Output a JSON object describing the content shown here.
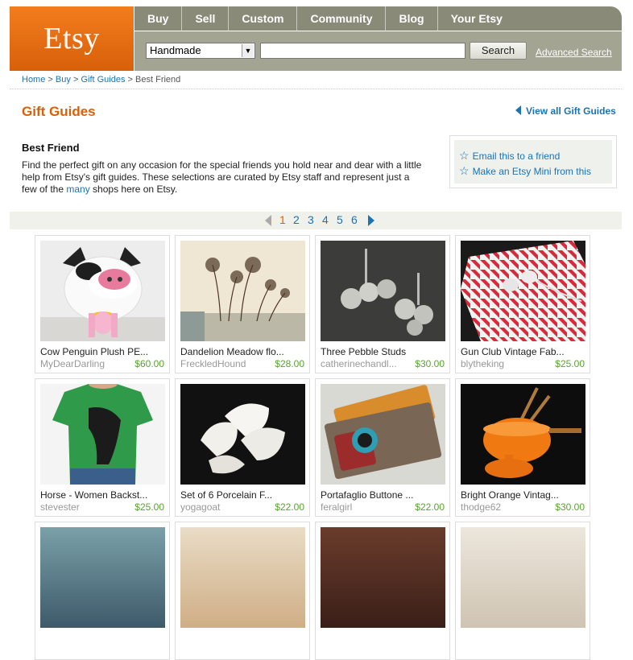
{
  "logo": "Etsy",
  "nav": [
    "Buy",
    "Sell",
    "Custom",
    "Community",
    "Blog",
    "Your Etsy"
  ],
  "search": {
    "category": "Handmade",
    "query": "",
    "button": "Search",
    "advanced": "Advanced Search"
  },
  "breadcrumb": {
    "home": "Home",
    "sep": ">",
    "buy": "Buy",
    "guides": "Gift Guides",
    "current": "Best Friend"
  },
  "page_title": "Gift Guides",
  "view_all": "View all Gift Guides",
  "section_title": "Best Friend",
  "description": {
    "before": "Find the perfect gift on any occasion for the special friends you hold near and dear with a little help from Etsy's gift guides. These selections are curated by Etsy staff and represent just a few of the ",
    "link": "many",
    "after": " shops here on Etsy."
  },
  "share": {
    "email": "Email this to a friend",
    "mini": "Make an Etsy Mini from this"
  },
  "pagination": {
    "current": "1",
    "pages": [
      "1",
      "2",
      "3",
      "4",
      "5",
      "6"
    ]
  },
  "items": [
    {
      "title": "Cow Penguin Plush PE...",
      "shop": "MyDearDarling",
      "price": "$60.00"
    },
    {
      "title": "Dandelion Meadow flo...",
      "shop": "FreckledHound",
      "price": "$28.00"
    },
    {
      "title": "Three Pebble Studs",
      "shop": "catherinechandl...",
      "price": "$30.00"
    },
    {
      "title": "Gun Club Vintage Fab...",
      "shop": "blytheking",
      "price": "$25.00"
    },
    {
      "title": "Horse - Women Backst...",
      "shop": "stevester",
      "price": "$25.00"
    },
    {
      "title": "Set of 6 Porcelain F...",
      "shop": "yogagoat",
      "price": "$22.00"
    },
    {
      "title": "Portafaglio Buttone ...",
      "shop": "feralgirl",
      "price": "$22.00"
    },
    {
      "title": "Bright Orange Vintag...",
      "shop": "thodge62",
      "price": "$30.00"
    }
  ],
  "colors": {
    "brand_orange": "#d8600a",
    "nav_gray": "#8a8a79",
    "link_blue": "#1b73b3",
    "price_green": "#5ba22f"
  }
}
